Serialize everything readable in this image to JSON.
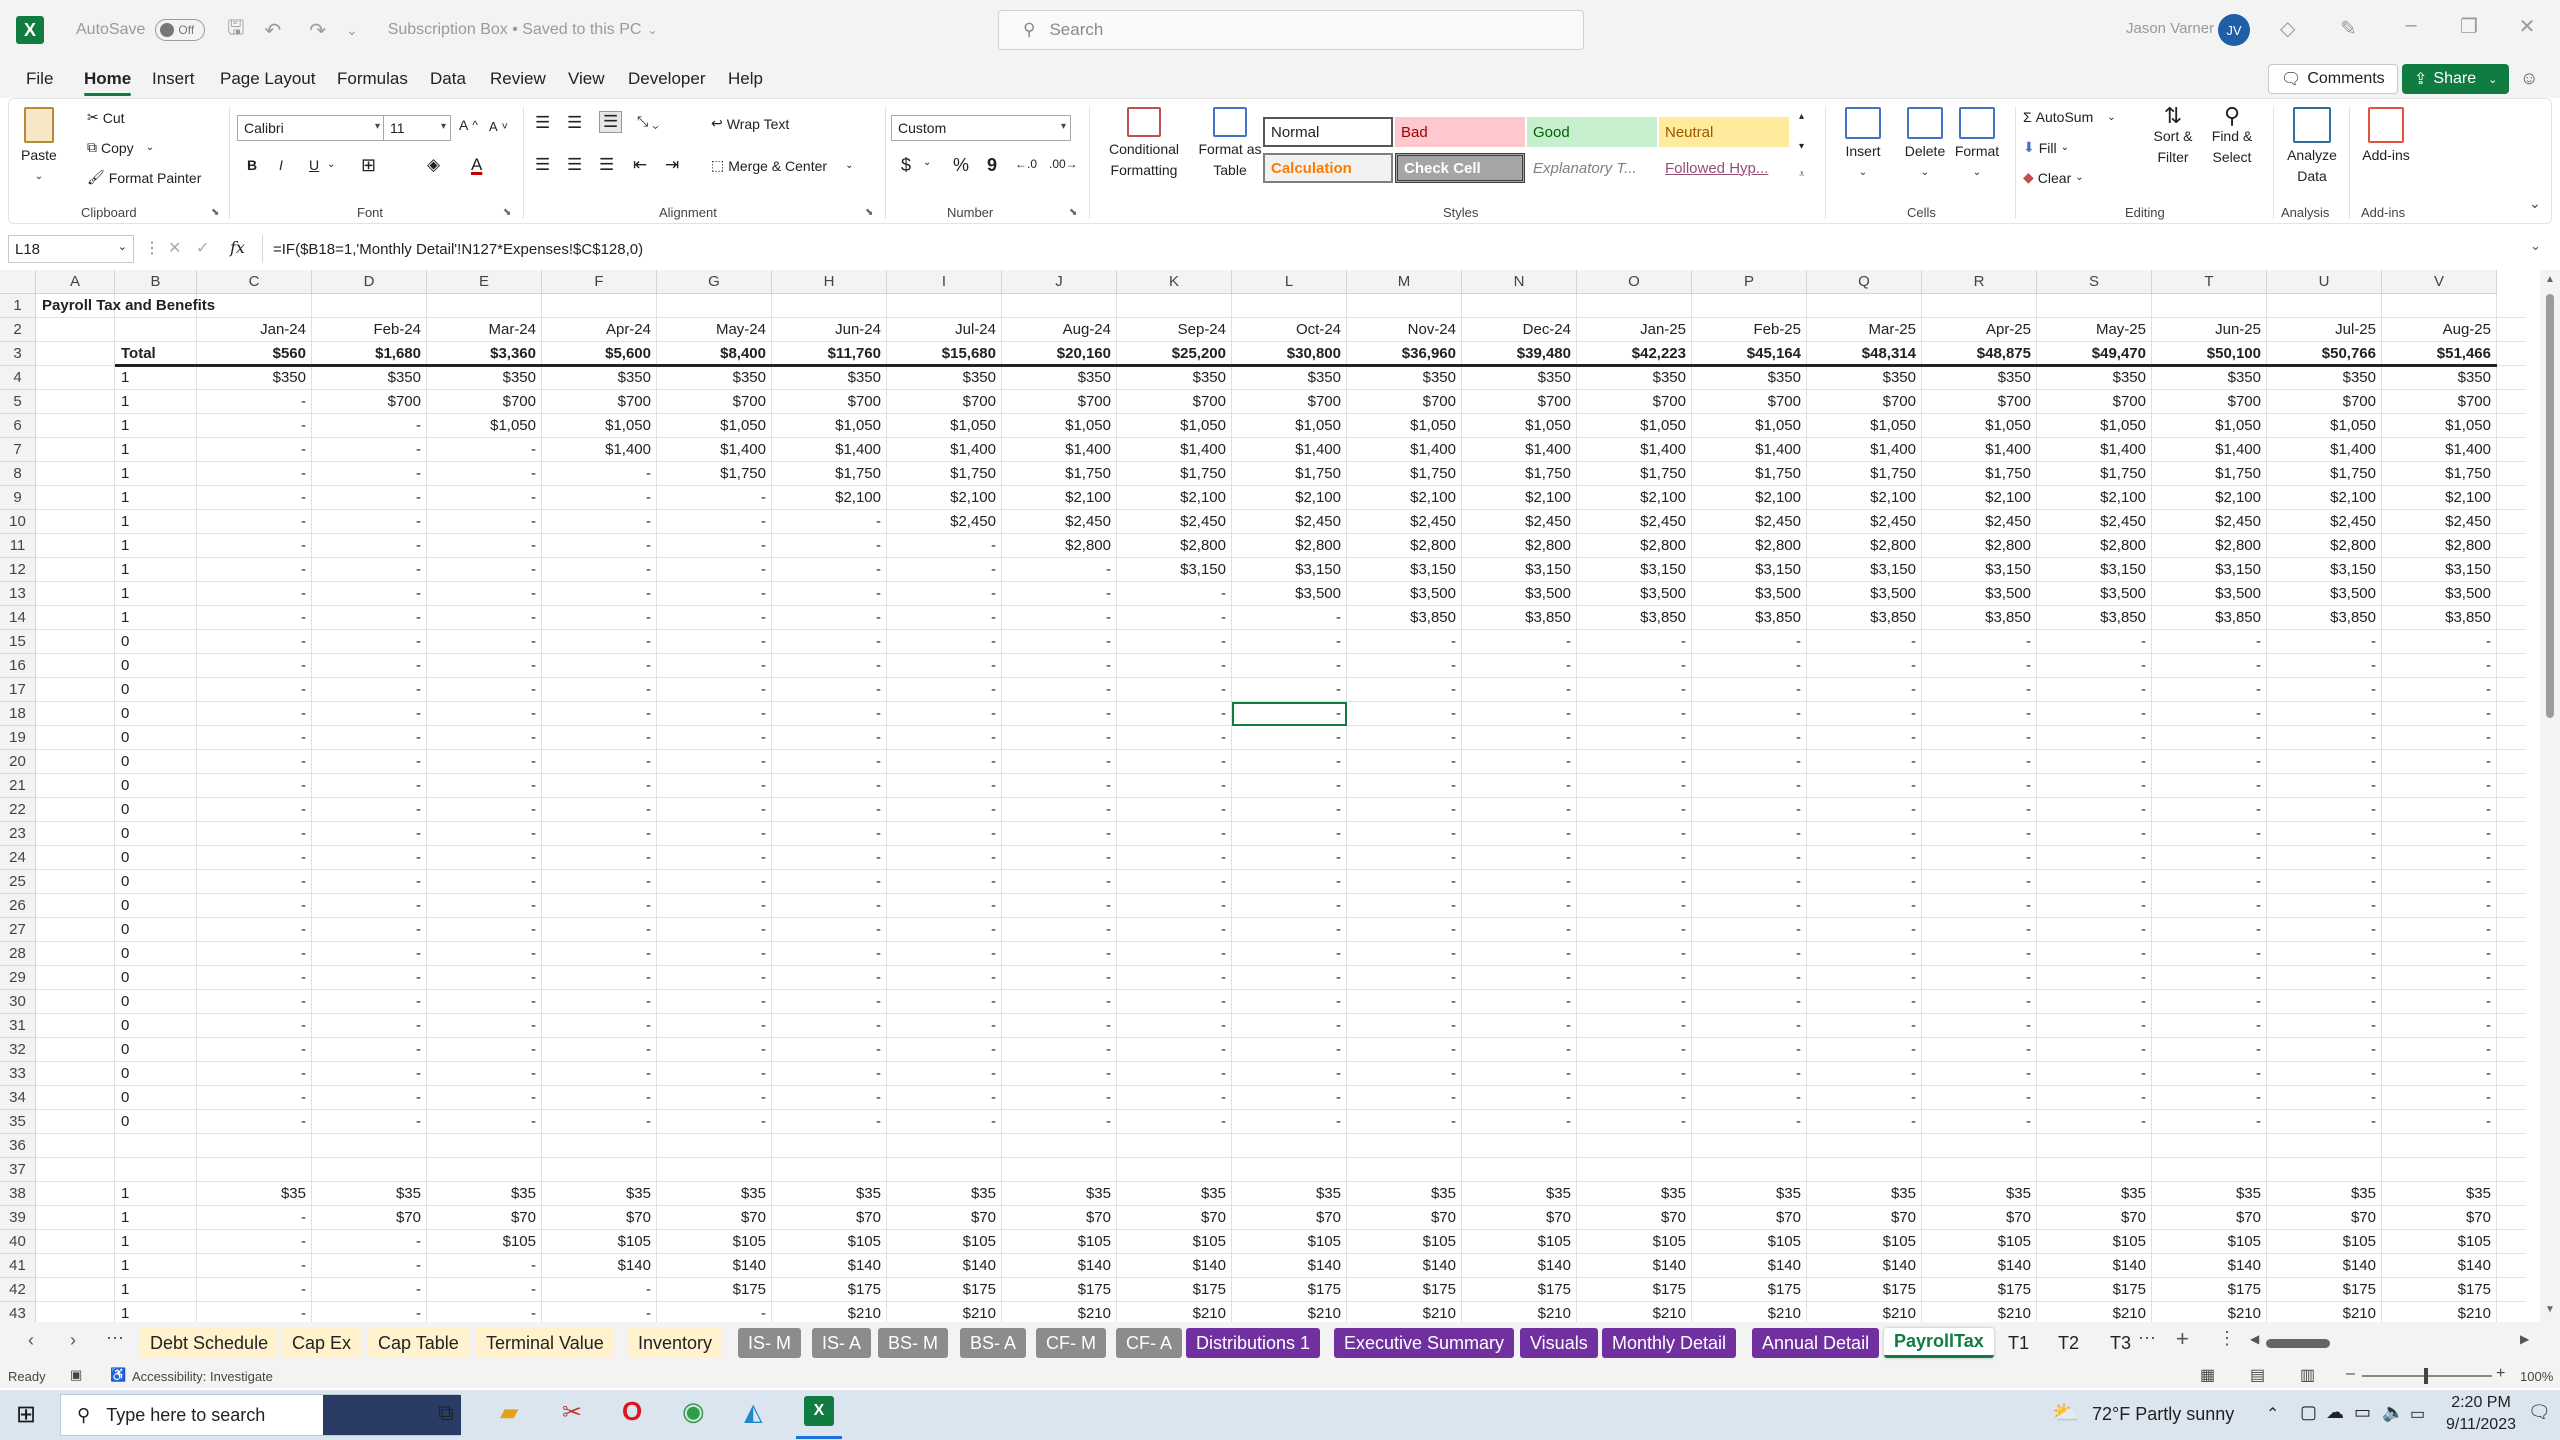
{
  "titlebar": {
    "autosave_label": "AutoSave",
    "autosave_state": "Off",
    "doc_title": "Subscription Box • Saved to this PC",
    "search_placeholder": "Search",
    "user_name": "Jason Varner",
    "user_initials": "JV"
  },
  "menu": {
    "tabs": [
      "File",
      "Home",
      "Insert",
      "Page Layout",
      "Formulas",
      "Data",
      "Review",
      "View",
      "Developer",
      "Help"
    ],
    "active": "Home",
    "comments": "Comments",
    "share": "Share"
  },
  "ribbon": {
    "clipboard": {
      "label": "Clipboard",
      "paste": "Paste",
      "cut": "Cut",
      "copy": "Copy",
      "format_painter": "Format Painter"
    },
    "font": {
      "label": "Font",
      "name": "Calibri",
      "size": "11",
      "bold": "B",
      "italic": "I",
      "underline": "U"
    },
    "alignment": {
      "label": "Alignment",
      "wrap_text": "Wrap Text",
      "merge_center": "Merge & Center"
    },
    "number": {
      "label": "Number",
      "format": "Custom",
      "currency": "$",
      "percent": "%",
      "comma": "9"
    },
    "styles": {
      "label": "Styles",
      "conditional": [
        "Conditional",
        "Formatting"
      ],
      "format_table": [
        "Format as",
        "Table"
      ],
      "cells": [
        {
          "name": "Normal",
          "bg": "#ffffff",
          "fg": "#222222"
        },
        {
          "name": "Bad",
          "bg": "#ffc7ce",
          "fg": "#9c0006"
        },
        {
          "name": "Good",
          "bg": "#c6efce",
          "fg": "#006100"
        },
        {
          "name": "Neutral",
          "bg": "#ffeb9c",
          "fg": "#9c5700"
        },
        {
          "name": "Calculation",
          "bg": "#f2f2f2",
          "fg": "#fa7d00"
        },
        {
          "name": "Check Cell",
          "bg": "#a5a5a5",
          "fg": "#ffffff"
        },
        {
          "name": "Explanatory T...",
          "bg": "#ffffff",
          "fg": "#7f7f7f"
        },
        {
          "name": "Followed Hyp...",
          "bg": "#ffffff",
          "fg": "#954f72"
        }
      ]
    },
    "cells": {
      "label": "Cells",
      "insert": "Insert",
      "delete": "Delete",
      "format": "Format"
    },
    "editing": {
      "label": "Editing",
      "autosum": "AutoSum",
      "fill": "Fill",
      "clear": "Clear",
      "sort_filter": [
        "Sort &",
        "Filter"
      ],
      "find_select": [
        "Find &",
        "Select"
      ]
    },
    "analysis": {
      "label": "Analysis",
      "analyze": [
        "Analyze",
        "Data"
      ]
    },
    "addins": {
      "label": "Add-ins",
      "addins": "Add-ins"
    }
  },
  "formula_bar": {
    "name_box": "L18",
    "fx": "fx",
    "formula": "=IF($B18=1,'Monthly Detail'!N127*Expenses!$C$128,0)"
  },
  "sheet": {
    "columns": [
      "A",
      "B",
      "C",
      "D",
      "E",
      "F",
      "G",
      "H",
      "I",
      "J",
      "K",
      "L",
      "M",
      "N",
      "O",
      "P",
      "Q",
      "R",
      "S",
      "T",
      "U",
      "V"
    ],
    "title": "Payroll Tax and Benefits",
    "months": [
      "Jan-24",
      "Feb-24",
      "Mar-24",
      "Apr-24",
      "May-24",
      "Jun-24",
      "Jul-24",
      "Aug-24",
      "Sep-24",
      "Oct-24",
      "Nov-24",
      "Dec-24",
      "Jan-25",
      "Feb-25",
      "Mar-25",
      "Apr-25",
      "May-25",
      "Jun-25",
      "Jul-25",
      "Aug-25"
    ],
    "total_label": "Total",
    "totals": [
      "$560",
      "$1,680",
      "$3,360",
      "$5,600",
      "$8,400",
      "$11,760",
      "$15,680",
      "$20,160",
      "$25,200",
      "$30,800",
      "$36,960",
      "$39,480",
      "$42,223",
      "$45,164",
      "$48,314",
      "$48,875",
      "$49,470",
      "$50,100",
      "$50,766",
      "$51,466"
    ],
    "block1": [
      {
        "flag": "1",
        "start": 0,
        "value": "$350"
      },
      {
        "flag": "1",
        "start": 1,
        "value": "$700"
      },
      {
        "flag": "1",
        "start": 2,
        "value": "$1,050"
      },
      {
        "flag": "1",
        "start": 3,
        "value": "$1,400"
      },
      {
        "flag": "1",
        "start": 4,
        "value": "$1,750"
      },
      {
        "flag": "1",
        "start": 5,
        "value": "$2,100"
      },
      {
        "flag": "1",
        "start": 6,
        "value": "$2,450"
      },
      {
        "flag": "1",
        "start": 7,
        "value": "$2,800"
      },
      {
        "flag": "1",
        "start": 8,
        "value": "$3,150"
      },
      {
        "flag": "1",
        "start": 9,
        "value": "$3,500"
      },
      {
        "flag": "1",
        "start": 10,
        "value": "$3,850"
      }
    ],
    "zero_rows": 21,
    "block2": [
      {
        "flag": "1",
        "start": 0,
        "value": "$35"
      },
      {
        "flag": "1",
        "start": 1,
        "value": "$70"
      },
      {
        "flag": "1",
        "start": 2,
        "value": "$105"
      },
      {
        "flag": "1",
        "start": 3,
        "value": "$140"
      },
      {
        "flag": "1",
        "start": 4,
        "value": "$175"
      },
      {
        "flag": "1",
        "start": 5,
        "value": "$210"
      }
    ]
  },
  "sheet_tabs": [
    {
      "name": "Debt Schedule",
      "bg": "#fff2cc",
      "fg": "#222222"
    },
    {
      "name": "Cap Ex",
      "bg": "#fff2cc",
      "fg": "#222222"
    },
    {
      "name": "Cap Table",
      "bg": "#fff2cc",
      "fg": "#222222"
    },
    {
      "name": "Terminal Value",
      "bg": "#fff2cc",
      "fg": "#222222"
    },
    {
      "name": "Inventory",
      "bg": "#fff2cc",
      "fg": "#222222"
    },
    {
      "name": "IS- M",
      "bg": "#8c8c8c",
      "fg": "#ffffff"
    },
    {
      "name": "IS- A",
      "bg": "#8c8c8c",
      "fg": "#ffffff"
    },
    {
      "name": "BS- M",
      "bg": "#8c8c8c",
      "fg": "#ffffff"
    },
    {
      "name": "BS- A",
      "bg": "#8c8c8c",
      "fg": "#ffffff"
    },
    {
      "name": "CF- M",
      "bg": "#8c8c8c",
      "fg": "#ffffff"
    },
    {
      "name": "CF- A",
      "bg": "#8c8c8c",
      "fg": "#ffffff"
    },
    {
      "name": "Distributions 1",
      "bg": "#7030a0",
      "fg": "#ffffff"
    },
    {
      "name": "Executive Summary",
      "bg": "#7030a0",
      "fg": "#ffffff"
    },
    {
      "name": "Visuals",
      "bg": "#7030a0",
      "fg": "#ffffff"
    },
    {
      "name": "Monthly Detail",
      "bg": "#7030a0",
      "fg": "#ffffff"
    },
    {
      "name": "Annual Detail",
      "bg": "#7030a0",
      "fg": "#ffffff"
    },
    {
      "name": "PayrollTax",
      "bg": "#ffffff",
      "fg": "#107c41"
    },
    {
      "name": "T1",
      "bg": "#f3f3f3",
      "fg": "#222222"
    },
    {
      "name": "T2",
      "bg": "#f3f3f3",
      "fg": "#222222"
    },
    {
      "name": "T3",
      "bg": "#f3f3f3",
      "fg": "#222222"
    }
  ],
  "active_tab": "PayrollTax",
  "status": {
    "ready": "Ready",
    "accessibility": "Accessibility: Investigate",
    "zoom": "100%"
  },
  "taskbar": {
    "search_placeholder": "Type here to search",
    "weather": "72°F  Partly sunny",
    "time": "2:20 PM",
    "date": "9/11/2023"
  },
  "colors": {
    "excel_green": "#107c41",
    "grid_line": "#e1e1e1",
    "header_bg": "#f3f3f3"
  }
}
